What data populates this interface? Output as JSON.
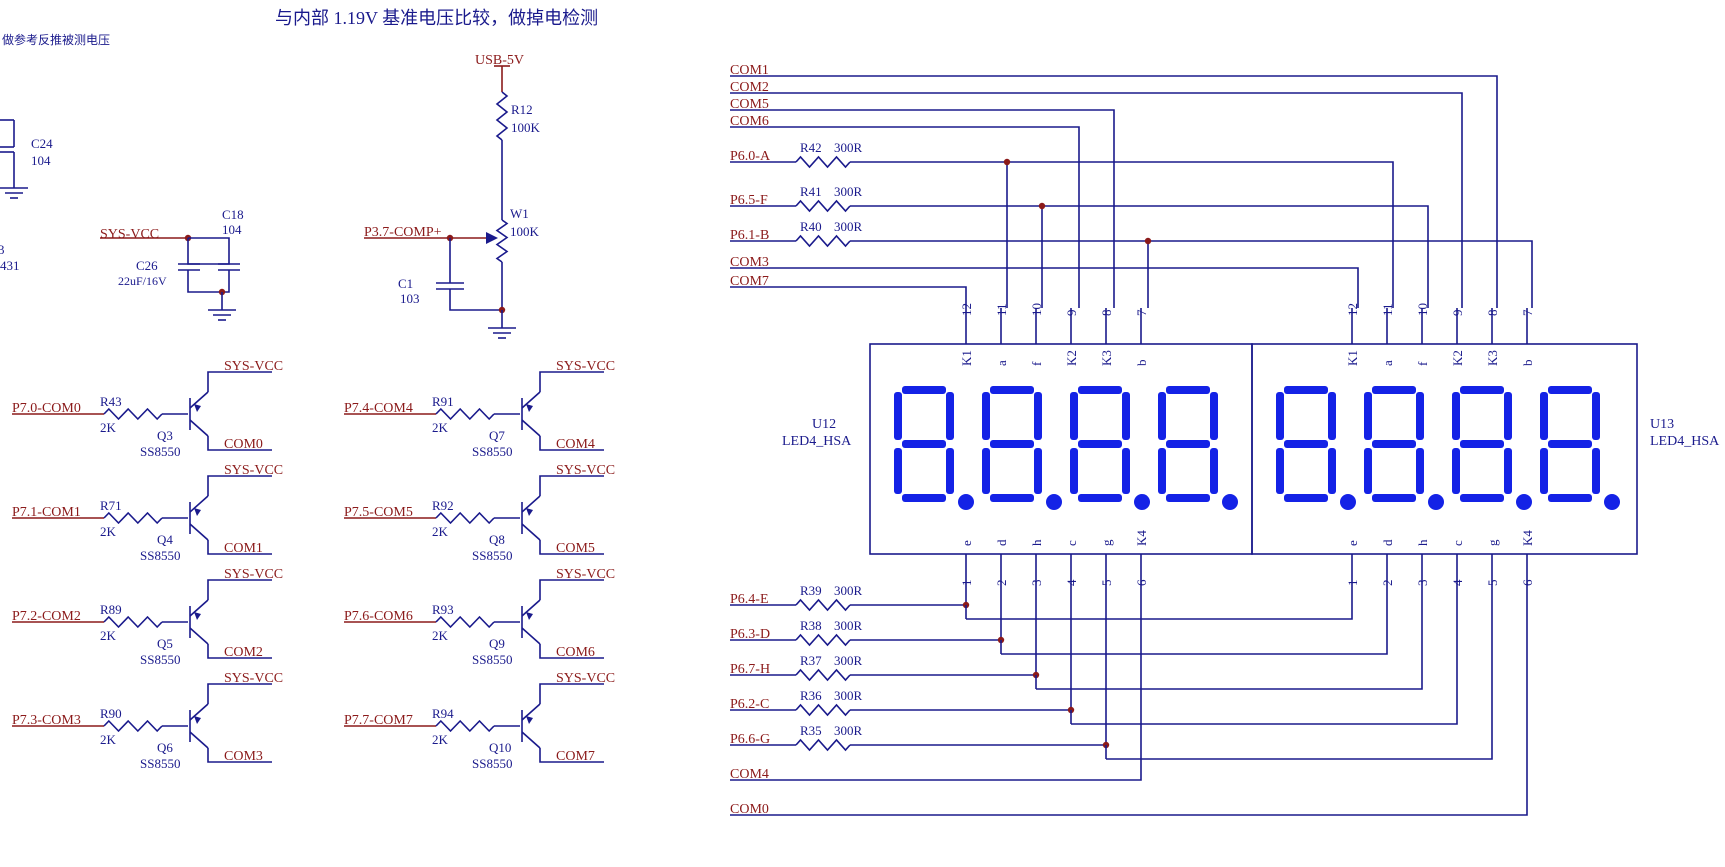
{
  "title": "与内部 1.19V 基准电压比较，做掉电检测",
  "note": "做参考反推被测电压",
  "colors": {
    "wire": "#1a1a8c",
    "net": "#8b1a1a",
    "segment": "#1422e6",
    "background": "#ffffff"
  },
  "fragments": {
    "c24_ref": "C24",
    "c24_val": "104",
    "left_a": "3",
    "left_b": "431"
  },
  "decoupling": {
    "net": "SYS-VCC",
    "c18_ref": "C18",
    "c18_val": "104",
    "c26_ref": "C26",
    "c26_val": "22uF/16V"
  },
  "comparator": {
    "usb_net": "USB-5V",
    "r12_ref": "R12",
    "r12_val": "100K",
    "w1_ref": "W1",
    "w1_val": "100K",
    "comp_net": "P3.7-COMP+",
    "c1_ref": "C1",
    "c1_val": "103"
  },
  "drivers": [
    {
      "input": "P7.0-COM0",
      "r_ref": "R43",
      "r_val": "2K",
      "q_ref": "Q3",
      "q_val": "SS8550",
      "vcc": "SYS-VCC",
      "out": "COM0"
    },
    {
      "input": "P7.1-COM1",
      "r_ref": "R71",
      "r_val": "2K",
      "q_ref": "Q4",
      "q_val": "SS8550",
      "vcc": "SYS-VCC",
      "out": "COM1"
    },
    {
      "input": "P7.2-COM2",
      "r_ref": "R89",
      "r_val": "2K",
      "q_ref": "Q5",
      "q_val": "SS8550",
      "vcc": "SYS-VCC",
      "out": "COM2"
    },
    {
      "input": "P7.3-COM3",
      "r_ref": "R90",
      "r_val": "2K",
      "q_ref": "Q6",
      "q_val": "SS8550",
      "vcc": "SYS-VCC",
      "out": "COM3"
    },
    {
      "input": "P7.4-COM4",
      "r_ref": "R91",
      "r_val": "2K",
      "q_ref": "Q7",
      "q_val": "SS8550",
      "vcc": "SYS-VCC",
      "out": "COM4"
    },
    {
      "input": "P7.5-COM5",
      "r_ref": "R92",
      "r_val": "2K",
      "q_ref": "Q8",
      "q_val": "SS8550",
      "vcc": "SYS-VCC",
      "out": "COM5"
    },
    {
      "input": "P7.6-COM6",
      "r_ref": "R93",
      "r_val": "2K",
      "q_ref": "Q9",
      "q_val": "SS8550",
      "vcc": "SYS-VCC",
      "out": "COM6"
    },
    {
      "input": "P7.7-COM7",
      "r_ref": "R94",
      "r_val": "2K",
      "q_ref": "Q10",
      "q_val": "SS8550",
      "vcc": "SYS-VCC",
      "out": "COM7"
    }
  ],
  "top_nets": [
    "COM1",
    "COM2",
    "COM5",
    "COM6",
    "P6.0-A",
    "P6.5-F",
    "P6.1-B",
    "COM3",
    "COM7"
  ],
  "bottom_nets": [
    "P6.4-E",
    "P6.3-D",
    "P6.7-H",
    "P6.2-C",
    "P6.6-G",
    "COM4",
    "COM0"
  ],
  "top_resistors": [
    {
      "ref": "R42",
      "val": "300R"
    },
    {
      "ref": "R41",
      "val": "300R"
    },
    {
      "ref": "R40",
      "val": "300R"
    }
  ],
  "bottom_resistors": [
    {
      "ref": "R39",
      "val": "300R"
    },
    {
      "ref": "R38",
      "val": "300R"
    },
    {
      "ref": "R37",
      "val": "300R"
    },
    {
      "ref": "R36",
      "val": "300R"
    },
    {
      "ref": "R35",
      "val": "300R"
    }
  ],
  "displays": [
    {
      "ref": "U12",
      "part": "LED4_HSA"
    },
    {
      "ref": "U13",
      "part": "LED4_HSA"
    }
  ],
  "top_pins": {
    "numbers": [
      "12",
      "11",
      "10",
      "9",
      "8",
      "7"
    ],
    "names": [
      "K1",
      "a",
      "f",
      "K2",
      "K3",
      "b"
    ]
  },
  "bottom_pins": {
    "numbers": [
      "1",
      "2",
      "3",
      "4",
      "5",
      "6"
    ],
    "names": [
      "e",
      "d",
      "h",
      "c",
      "g",
      "K4"
    ]
  }
}
